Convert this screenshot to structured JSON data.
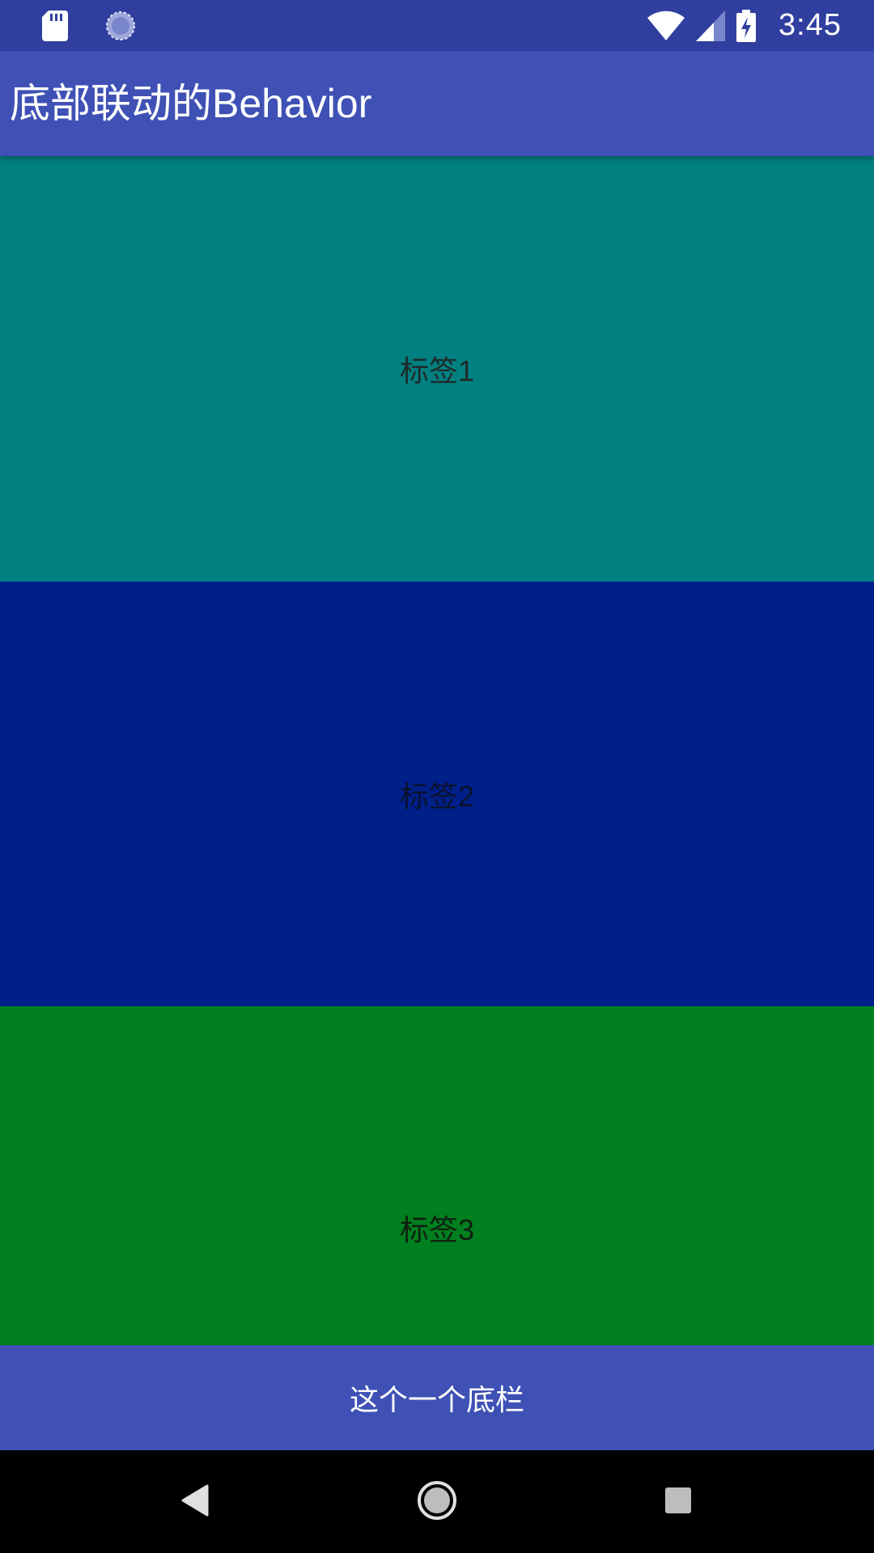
{
  "status_bar": {
    "time": "3:45",
    "left_icons": [
      "sd-card-icon",
      "loading-icon"
    ],
    "right_icons": [
      "wifi-icon",
      "cell-signal-icon",
      "battery-charging-icon"
    ],
    "background": "#303F9F"
  },
  "app_bar": {
    "title": "底部联动的Behavior",
    "background": "#3F51B5"
  },
  "panels": [
    {
      "label": "标签1",
      "color": "#008080"
    },
    {
      "label": "标签2",
      "color": "#001F88"
    },
    {
      "label": "标签3",
      "color": "#007F1F"
    }
  ],
  "bottom_bar": {
    "label": "这个一个底栏",
    "background": "#3F51B5"
  },
  "nav_bar": {
    "buttons": [
      "back-icon",
      "home-icon",
      "recents-icon"
    ]
  }
}
